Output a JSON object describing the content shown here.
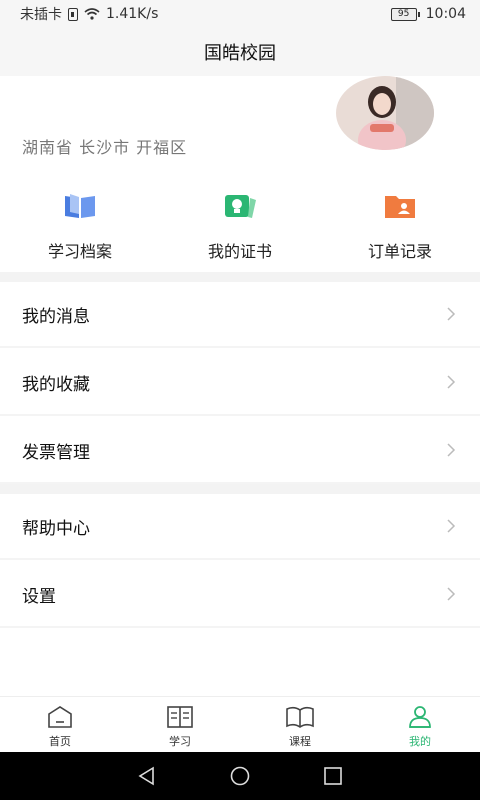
{
  "status": {
    "carrier": "未插卡",
    "speed": "1.41K/s",
    "battery": "95",
    "time": "10:04"
  },
  "header": {
    "title": "国皓校园"
  },
  "profile": {
    "location": "湖南省 长沙市 开福区"
  },
  "quick_actions": [
    {
      "label": "学习档案",
      "icon": "book-icon",
      "color": "#4a7de0"
    },
    {
      "label": "我的证书",
      "icon": "certificate-icon",
      "color": "#2bb673"
    },
    {
      "label": "订单记录",
      "icon": "folder-user-icon",
      "color": "#f07b3f"
    }
  ],
  "menu": {
    "messages": "我的消息",
    "favorites": "我的收藏",
    "invoice": "发票管理",
    "help": "帮助中心",
    "settings": "设置"
  },
  "tabs": [
    {
      "label": "首页",
      "icon": "home-icon",
      "active": false
    },
    {
      "label": "学习",
      "icon": "study-icon",
      "active": false
    },
    {
      "label": "课程",
      "icon": "course-icon",
      "active": false
    },
    {
      "label": "我的",
      "icon": "profile-icon",
      "active": true
    }
  ],
  "colors": {
    "accent": "#2bb673",
    "text": "#222222",
    "muted": "#777777"
  }
}
